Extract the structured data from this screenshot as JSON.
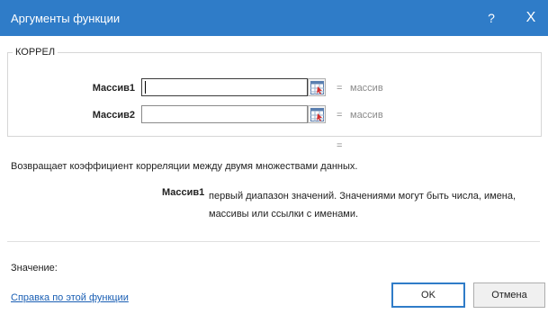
{
  "window": {
    "title": "Аргументы функции",
    "help_label": "?",
    "close_label": "X"
  },
  "function": {
    "name": "КОРРЕЛ"
  },
  "arguments": [
    {
      "label": "Массив1",
      "value": "",
      "result": "массив"
    },
    {
      "label": "Массив2",
      "value": "",
      "result": "массив"
    }
  ],
  "equals_sign": "=",
  "result_equals": "=",
  "description": "Возвращает коэффициент корреляции между двумя множествами данных.",
  "arg_help": {
    "name": "Массив1",
    "text": "первый диапазон значений. Значениями могут быть числа, имена, массивы или ссылки с именами."
  },
  "value_label": "Значение:",
  "help_link": "Справка по этой функции",
  "buttons": {
    "ok": "OK",
    "cancel": "Отмена"
  },
  "colors": {
    "titlebar": "#2f7cc8",
    "link": "#1a5fb4"
  }
}
